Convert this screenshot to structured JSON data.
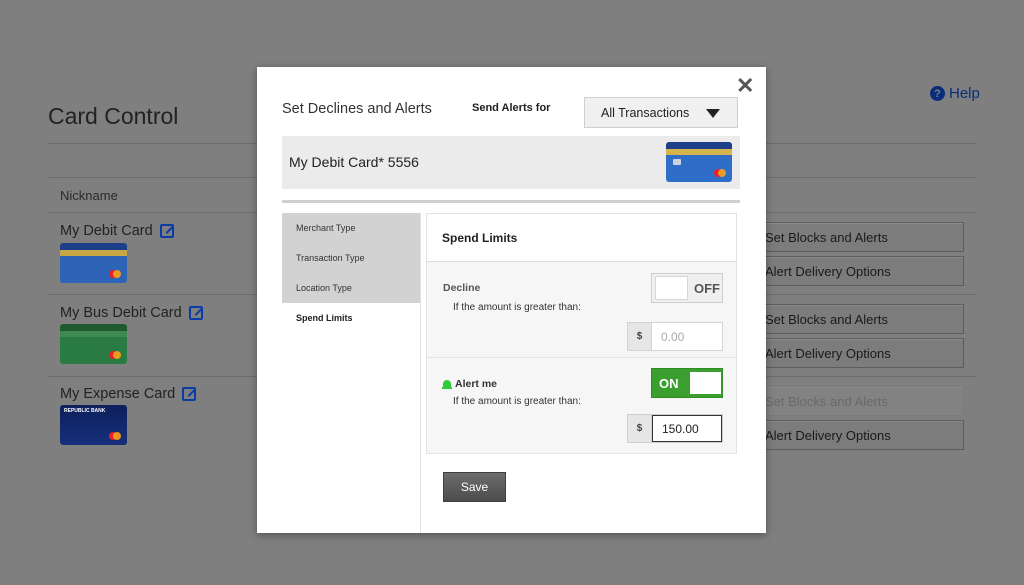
{
  "page": {
    "title": "Card Control",
    "help_label": "Help",
    "nickname_header": "Nickname",
    "cards": [
      {
        "name": "My Debit Card"
      },
      {
        "name": "My Bus Debit Card"
      },
      {
        "name": "My Expense Card",
        "bank_text": "REPUBLIC BANK"
      }
    ],
    "side_buttons": [
      {
        "label": "Set Blocks and Alerts"
      },
      {
        "label": "Alert Delivery Options"
      },
      {
        "label": "Set Blocks and Alerts"
      },
      {
        "label": "Alert Delivery Options"
      },
      {
        "label": "Set Blocks and Alerts",
        "disabled": true
      },
      {
        "label": "Alert Delivery Options"
      }
    ]
  },
  "modal": {
    "title": "Set Declines and Alerts",
    "send_alerts_label": "Send Alerts for",
    "send_alerts_value": "All Transactions",
    "card_label": "My Debit Card* 5556",
    "tabs": [
      {
        "label": "Merchant Type"
      },
      {
        "label": "Transaction Type"
      },
      {
        "label": "Location Type"
      },
      {
        "label": "Spend Limits",
        "active": true
      }
    ],
    "panel_title": "Spend Limits",
    "decline": {
      "title": "Decline",
      "subtitle": "If the amount is greater than:",
      "toggle": "OFF",
      "currency": "$",
      "placeholder": "0.00"
    },
    "alert": {
      "title": "Alert me",
      "subtitle": "If the amount is greater than:",
      "toggle": "ON",
      "currency": "$",
      "value": "150.00"
    },
    "save_label": "Save"
  },
  "colors": {
    "overlay": "#7f7f7f",
    "accent_blue": "#0a2d7a",
    "toggle_on": "#3a9f2e",
    "bell": "#2ecc3a"
  }
}
